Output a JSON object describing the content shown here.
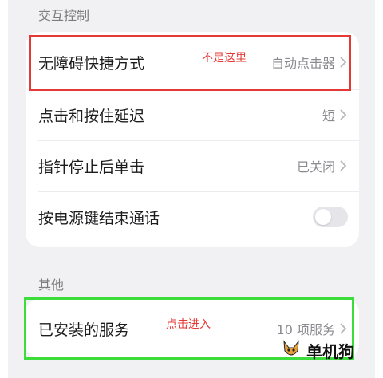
{
  "sections": {
    "interaction_title": "交互控制",
    "other_title": "其他"
  },
  "interaction_rows": {
    "shortcut": {
      "label": "无障碍快捷方式",
      "value": "自动点击器"
    },
    "delay": {
      "label": "点击和按住延迟",
      "value": "短"
    },
    "dwell": {
      "label": "指针停止后单击",
      "value": "已关闭"
    },
    "power": {
      "label": "按电源键结束通话",
      "toggle_on": false
    }
  },
  "other_rows": {
    "installed": {
      "label": "已安装的服务",
      "value": "10 项服务"
    }
  },
  "annotations": {
    "not_here": "不是这里",
    "tap_to_enter": "点击进入"
  },
  "watermark": {
    "text": "单机狗"
  },
  "colors": {
    "red_box": "#e53935",
    "green_box": "#3ddc3d",
    "annotation_text": "#e53935"
  }
}
